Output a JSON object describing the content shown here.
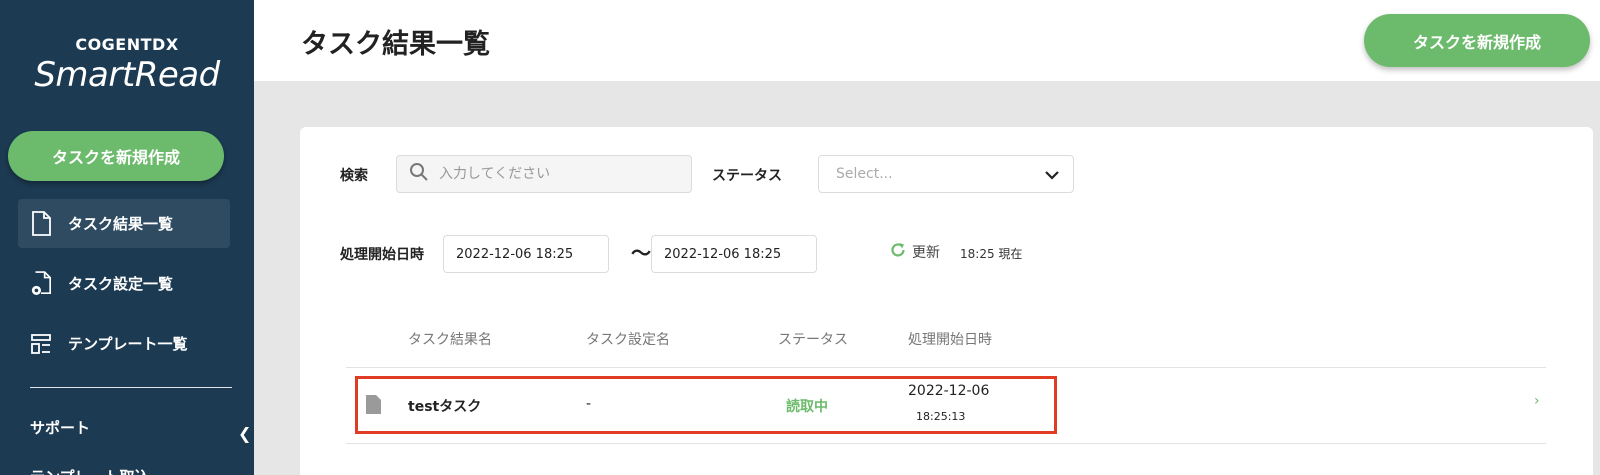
{
  "brand": {
    "top": "COGENTDX",
    "main": "SmartRead"
  },
  "sidebar": {
    "new_task": "タスクを新規作成",
    "items": [
      {
        "label": "タスク結果一覧",
        "icon": "document-icon",
        "active": true
      },
      {
        "label": "タスク設定一覧",
        "icon": "document-gear-icon",
        "active": false
      },
      {
        "label": "テンプレート一覧",
        "icon": "template-icon",
        "active": false
      }
    ],
    "support": "サポート",
    "template_import": "テンプレート取込"
  },
  "header": {
    "title": "タスク結果一覧",
    "new_task": "タスクを新規作成"
  },
  "filters": {
    "search_label": "検索",
    "search_placeholder": "入力してください",
    "status_label": "ステータス",
    "status_placeholder": "Select...",
    "date_label": "処理開始日時",
    "date_from": "2022-12-06 18:25",
    "tilde": "～",
    "date_to": "2022-12-06 18:25",
    "refresh_label": "更新",
    "as_of": "18:25 現在"
  },
  "table": {
    "columns": [
      "タスク結果名",
      "タスク設定名",
      "ステータス",
      "処理開始日時"
    ],
    "rows": [
      {
        "name": "testタスク",
        "setting": "-",
        "status": "読取中",
        "date": "2022-12-06",
        "time": "18:25:13"
      }
    ]
  },
  "colors": {
    "accent": "#6cba6c",
    "sidebar": "#1c3a52",
    "highlight": "#e03c24"
  }
}
